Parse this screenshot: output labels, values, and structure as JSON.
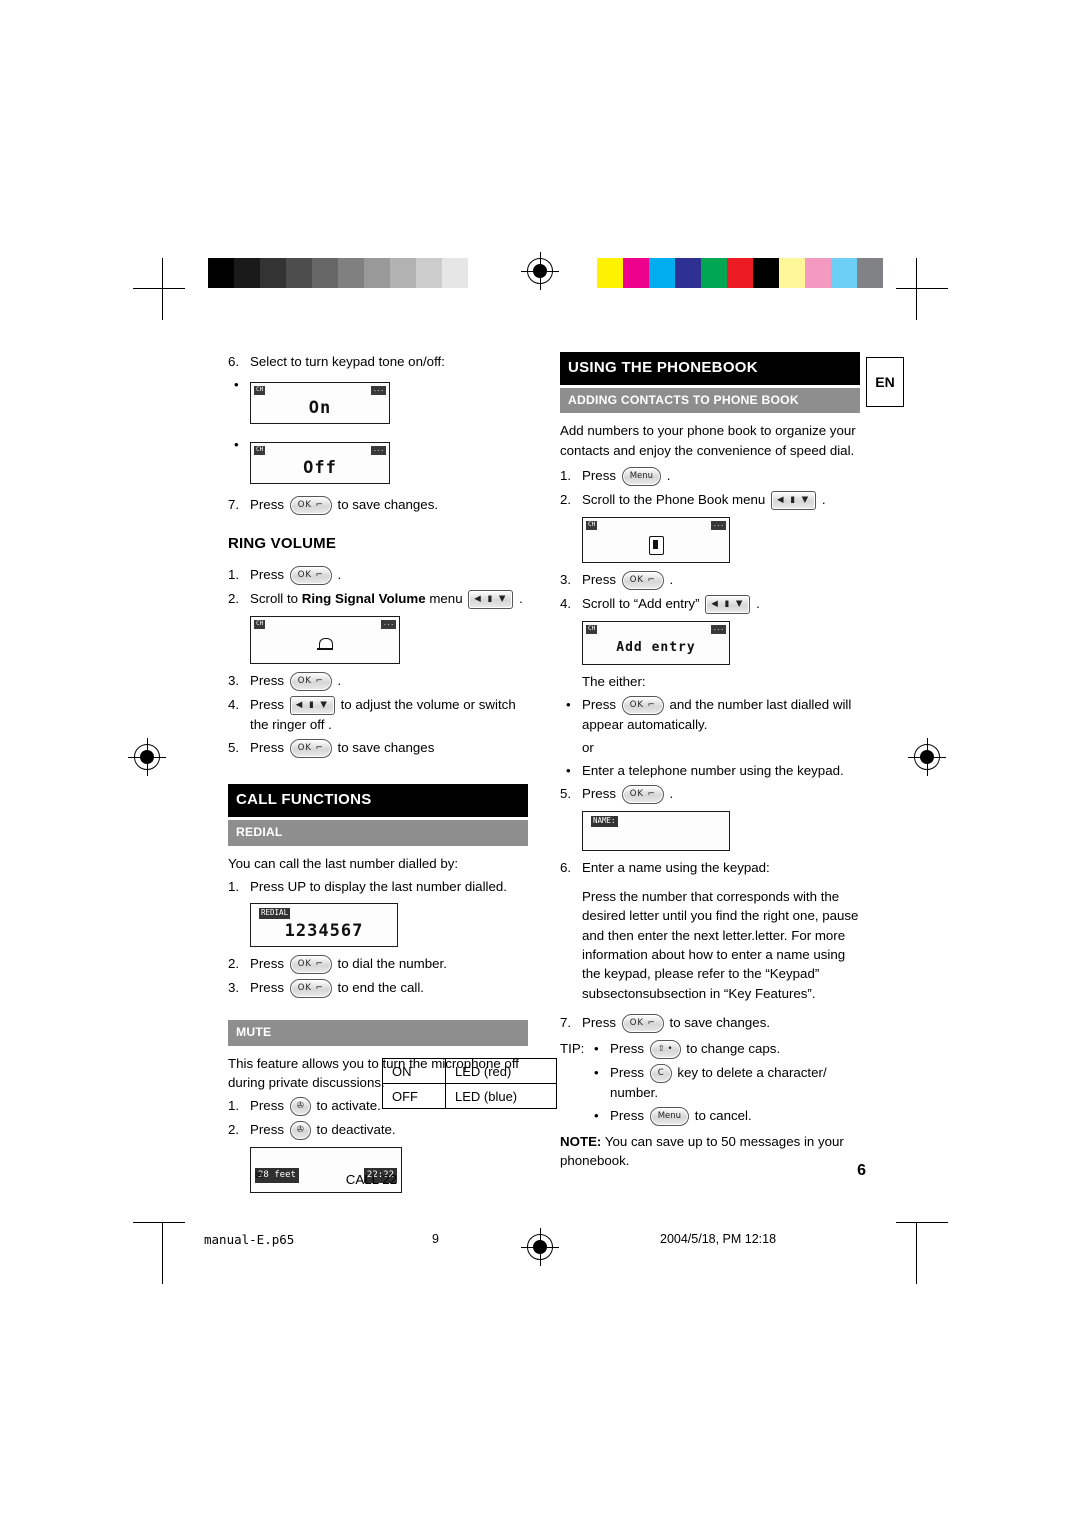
{
  "page": {
    "number": "6",
    "language_badge": "EN"
  },
  "footer": {
    "file": "manual-E.p65",
    "page": "9",
    "date": "2004/5/18, PM 12:18"
  },
  "left_column": {
    "step6": {
      "num": "6.",
      "text": "Select to turn keypad tone on/off:"
    },
    "lcd_on": {
      "left_label": "CH",
      "right_label": "...",
      "text": "On"
    },
    "lcd_off": {
      "left_label": "CH",
      "right_label": "...",
      "text": "Off"
    },
    "step7": {
      "num": "7.",
      "pre": "Press",
      "key": "OK",
      "post": "to save changes."
    },
    "ring_volume": {
      "heading": "RING VOLUME",
      "step1": {
        "num": "1.",
        "pre": "Press",
        "key": "OK",
        "post": "."
      },
      "step2": {
        "num": "2.",
        "pre": "Scroll to",
        "bold": "Ring Signal Volume",
        "mid": "menu",
        "key": "NAV",
        "post": "."
      },
      "lcd": {
        "left_label": "CH",
        "right_label": "...",
        "icon": "bell-icon"
      },
      "step3": {
        "num": "3.",
        "pre": "Press",
        "key": "OK",
        "post": "."
      },
      "step4": {
        "num": "4.",
        "pre": "Press",
        "key": "NAV",
        "post": "to adjust the volume or switch the ringer off ."
      },
      "step5": {
        "num": "5.",
        "pre": "Press",
        "key": "OK",
        "post": "to save changes"
      }
    },
    "call_functions": {
      "heading": "CALL FUNCTIONS",
      "redial": {
        "heading": "REDIAL",
        "intro": "You can call the last number dialled by:",
        "step1": {
          "num": "1.",
          "text": "Press UP to display the last number dialled."
        },
        "lcd": {
          "top_label": "REDIAL",
          "value": "1234567"
        },
        "step2": {
          "num": "2.",
          "pre": "Press",
          "key": "OK",
          "post": "to dial the number."
        },
        "step3": {
          "num": "3.",
          "pre": "Press",
          "key": "OK",
          "post": "to end the call."
        }
      },
      "mute": {
        "heading": "MUTE",
        "intro": "This feature allows you to turn the microphone off during private discussions.",
        "step1": {
          "num": "1.",
          "pre": "Press",
          "key": "MUTE",
          "post": "to activate."
        },
        "step2": {
          "num": "2.",
          "pre": "Press",
          "key": "MUTE",
          "post": "to deactivate."
        },
        "lcd": {
          "left_label": "28 feet",
          "right_label": "22:22",
          "bottom_label": "CALL 22"
        },
        "table": {
          "rows": [
            {
              "state": "ON",
              "led": "LED (red)"
            },
            {
              "state": "OFF",
              "led": "LED (blue)"
            }
          ]
        }
      }
    }
  },
  "right_column": {
    "phonebook": {
      "heading": "USING THE PHONEBOOK",
      "sub_heading": "ADDING CONTACTS TO PHONE BOOK",
      "intro": "Add numbers to your phone book to organize your contacts and enjoy the convenience of speed dial.",
      "step1": {
        "num": "1.",
        "pre": "Press",
        "key": "Menu",
        "post": "."
      },
      "step2": {
        "num": "2.",
        "pre": "Scroll to the Phone Book menu",
        "key": "NAV",
        "post": "."
      },
      "lcd_phonebook": {
        "left_label": "CH",
        "right_label": "...",
        "icon": "phonebook-icon"
      },
      "step3": {
        "num": "3.",
        "pre": "Press",
        "key": "OK",
        "post": "."
      },
      "step4": {
        "num": "4.",
        "pre": "Scroll to “Add entry”",
        "key": "NAV",
        "post": "."
      },
      "lcd_addentry": {
        "left_label": "CH",
        "right_label": "...",
        "text": "Add entry"
      },
      "either": "The either:",
      "bullet1": {
        "pre": "Press",
        "key": "OK",
        "post": "and the number last dialled will appear automatically."
      },
      "or": "or",
      "bullet2": "Enter a telephone number using the keypad.",
      "step5": {
        "num": "5.",
        "pre": "Press",
        "key": "OK",
        "post": "."
      },
      "lcd_name": {
        "top_label": "NAME:"
      },
      "step6": {
        "num": "6.",
        "text": "Enter a name using the keypad:"
      },
      "para": "Press the number that corresponds with the desired letter until you find the right one, pause and then enter the next letter.letter. For more information about how to enter a name using the keypad, please refer to the “Keypad” subsectonsubsection in “Key Features”.",
      "step7": {
        "num": "7.",
        "pre": "Press",
        "key": "OK",
        "post": "to save changes."
      },
      "tip_label": "TIP:",
      "tip1": {
        "pre": "Press",
        "key": "SHIFT",
        "post": "to change caps."
      },
      "tip2": {
        "pre": "Press",
        "key": "C",
        "post": "key to delete a character/ number."
      },
      "tip3": {
        "pre": "Press",
        "key": "Menu",
        "post": "to cancel."
      },
      "note_label": "NOTE:",
      "note_text": "You can save up to 50 messages in your phonebook."
    }
  },
  "keys": {
    "ok": "OK ⌐",
    "nav": "◀ ▮ ▼",
    "menu": "Menu",
    "mute": "✇",
    "shift": "⇧ •",
    "c": "C",
    "ok_plain": "OK"
  },
  "calibration": {
    "grayscale": [
      "#000000",
      "#1a1a1a",
      "#333333",
      "#4d4d4d",
      "#666666",
      "#808080",
      "#999999",
      "#b3b3b3",
      "#cccccc",
      "#e6e6e6",
      "#ffffff"
    ],
    "colors": [
      "#fff200",
      "#ec008c",
      "#00aeef",
      "#2e3192",
      "#00a651",
      "#ed1c24",
      "#000000",
      "#fff799",
      "#f49ac1",
      "#6dcff6",
      "#808285"
    ]
  }
}
